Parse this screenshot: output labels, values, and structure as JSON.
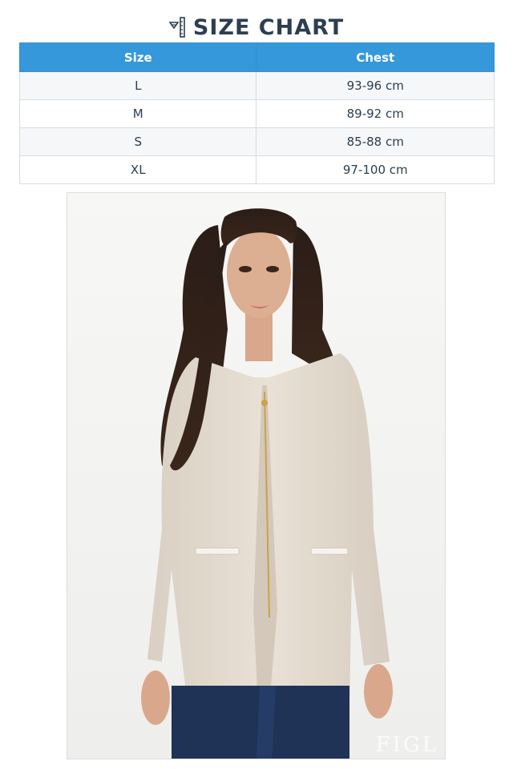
{
  "title": "SIZE CHART",
  "title_icon": "ruler-icon",
  "table": {
    "headers": [
      "Size",
      "Chest"
    ],
    "rows": [
      [
        "L",
        "93-96 cm"
      ],
      [
        "M",
        "89-92 cm"
      ],
      [
        "S",
        "85-88 cm"
      ],
      [
        "XL",
        "97-100 cm"
      ]
    ]
  },
  "photo": {
    "subject": "model wearing beige collarless jacket",
    "watermark": "FIGL"
  },
  "colors": {
    "header_bg": "#3498db",
    "header_text": "#ffffff",
    "title_text": "#2c3e50",
    "row_alt": "#f5f7f9",
    "jacket": "#e6ddd2"
  }
}
